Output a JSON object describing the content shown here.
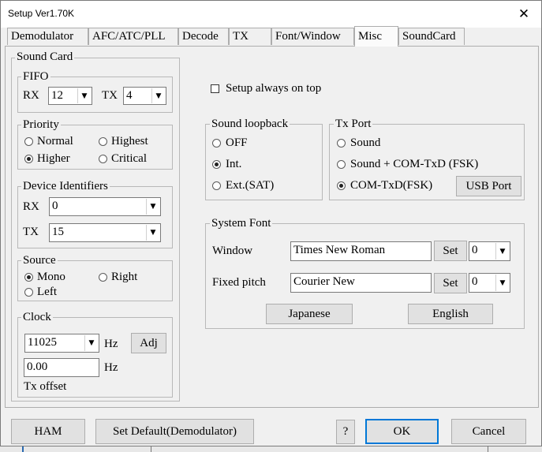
{
  "window": {
    "title": "Setup Ver1.70K"
  },
  "tabs": [
    {
      "label": "Demodulator"
    },
    {
      "label": "AFC/ATC/PLL"
    },
    {
      "label": "Decode"
    },
    {
      "label": "TX"
    },
    {
      "label": "Font/Window"
    },
    {
      "label": "Misc"
    },
    {
      "label": "SoundCard"
    }
  ],
  "active_tab": "Misc",
  "sound_card": {
    "title": "Sound Card",
    "fifo": {
      "title": "FIFO",
      "rx_label": "RX",
      "rx_value": "12",
      "tx_label": "TX",
      "tx_value": "4"
    },
    "priority": {
      "title": "Priority",
      "options": [
        "Normal",
        "Highest",
        "Higher",
        "Critical"
      ],
      "selected": "Higher"
    },
    "device_ids": {
      "title": "Device Identifiers",
      "rx_label": "RX",
      "rx_value": "0",
      "tx_label": "TX",
      "tx_value": "15"
    },
    "source": {
      "title": "Source",
      "options": [
        "Mono",
        "Right",
        "Left"
      ],
      "selected": "Mono"
    },
    "clock": {
      "title": "Clock",
      "rate": "11025",
      "rate_unit": "Hz",
      "adj_label": "Adj",
      "offset": "0.00",
      "offset_unit": "Hz",
      "offset_label": "Tx offset"
    }
  },
  "setup_on_top": {
    "label": "Setup always on top",
    "checked": false
  },
  "sound_loopback": {
    "title": "Sound loopback",
    "options": [
      "OFF",
      "Int.",
      "Ext.(SAT)"
    ],
    "selected": "Int."
  },
  "tx_port": {
    "title": "Tx Port",
    "options": [
      "Sound",
      "Sound + COM-TxD (FSK)",
      "COM-TxD(FSK)"
    ],
    "selected": "COM-TxD(FSK)",
    "usb_label": "USB Port"
  },
  "system_font": {
    "title": "System Font",
    "window_label": "Window",
    "window_font": "Times New Roman",
    "window_size": "0",
    "fixed_label": "Fixed pitch",
    "fixed_font": "Courier New",
    "fixed_size": "0",
    "set_label": "Set",
    "japanese_label": "Japanese",
    "english_label": "English"
  },
  "footer": {
    "ham_label": "HAM",
    "set_default_label": "Set Default(Demodulator)",
    "help_label": "?",
    "ok_label": "OK",
    "cancel_label": "Cancel"
  }
}
